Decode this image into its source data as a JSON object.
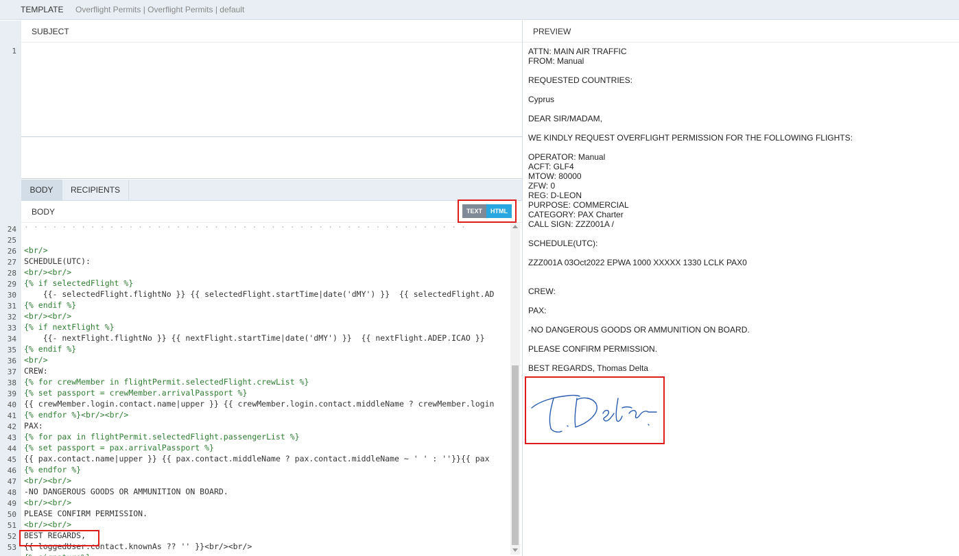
{
  "topbar": {
    "template_label": "TEMPLATE",
    "breadcrumb": "Overflight Permits | Overflight Permits | default"
  },
  "subject": {
    "heading": "SUBJECT",
    "line_number": "1"
  },
  "tabs": [
    {
      "label": "BODY",
      "active": true
    },
    {
      "label": "RECIPIENTS",
      "active": false
    }
  ],
  "body": {
    "heading": "BODY",
    "toggle_text": "TEXT",
    "toggle_html": "HTML"
  },
  "code": {
    "line_numbers": [
      "24",
      "25",
      "26",
      "27",
      "28",
      "29",
      "30",
      "31",
      "32",
      "33",
      "34",
      "35",
      "36",
      "37",
      "38",
      "39",
      "40",
      "41",
      "42",
      "43",
      "44",
      "45",
      "46",
      "47",
      "48",
      "49",
      "50",
      "51",
      "52",
      "53"
    ],
    "lines": [
      "<br/>",
      "SCHEDULE(UTC):",
      "<br/><br/>",
      "{% if selectedFlight %}",
      "    {{- selectedFlight.flightNo }} {{ selectedFlight.startTime|date('dMY') }}  {{ selectedFlight.AD",
      "{% endif %}",
      "<br/><br/>",
      "{% if nextFlight %}",
      "    {{- nextFlight.flightNo }} {{ nextFlight.startTime|date('dMY') }}  {{ nextFlight.ADEP.ICAO }}",
      "{% endif %}",
      "<br/>",
      "CREW:",
      "{% for crewMember in flightPermit.selectedFlight.crewList %}",
      "{% set passport = crewMember.arrivalPassport %}",
      "{{ crewMember.login.contact.name|upper }} {{ crewMember.login.contact.middleName ? crewMember.login",
      "{% endfor %}<br/><br/>",
      "PAX:",
      "{% for pax in flightPermit.selectedFlight.passengerList %}",
      "{% set passport = pax.arrivalPassport %}",
      "{{ pax.contact.name|upper }} {{ pax.contact.middleName ? pax.contact.middleName ~ ' ' : ''}}{{ pax",
      "{% endfor %}",
      "<br/><br/>",
      "-NO DANGEROUS GOODS OR AMMUNITION ON BOARD.",
      "<br/><br/>",
      "PLEASE CONFIRM PERMISSION.",
      "<br/><br/>",
      "BEST REGARDS,",
      "{{ loggedUser.contact.knownAs ?? '' }}<br/><br/>",
      "{% signature%}",
      ""
    ]
  },
  "preview": {
    "heading": "PREVIEW",
    "lines": [
      "ATTN: MAIN AIR TRAFFIC",
      "FROM: Manual",
      "",
      "REQUESTED COUNTRIES:",
      "",
      "Cyprus",
      "",
      "DEAR SIR/MADAM,",
      "",
      "WE KINDLY REQUEST OVERFLIGHT PERMISSION FOR THE FOLLOWING FLIGHTS:",
      "",
      "OPERATOR: Manual",
      "ACFT: GLF4",
      "MTOW: 80000",
      "ZFW: 0",
      "REG: D-LEON",
      "PURPOSE: COMMERCIAL",
      "CATEGORY: PAX Charter",
      "CALL SIGN: ZZZ001A /",
      "",
      "SCHEDULE(UTC):",
      "",
      "ZZZ001A 03Oct2022 EPWA 1000 XXXXX 1330 LCLK PAX0",
      "",
      "",
      "CREW:",
      "",
      "PAX:",
      "",
      "-NO DANGEROUS GOODS OR AMMUNITION ON BOARD.",
      "",
      "PLEASE CONFIRM PERMISSION.",
      "",
      "BEST REGARDS, Thomas Delta"
    ]
  },
  "colors": {
    "highlight_border": "#e01b1b",
    "toggle_active": "#29a8e0",
    "toggle_inactive": "#7f8a96",
    "signature_ink": "#2a5db0"
  }
}
